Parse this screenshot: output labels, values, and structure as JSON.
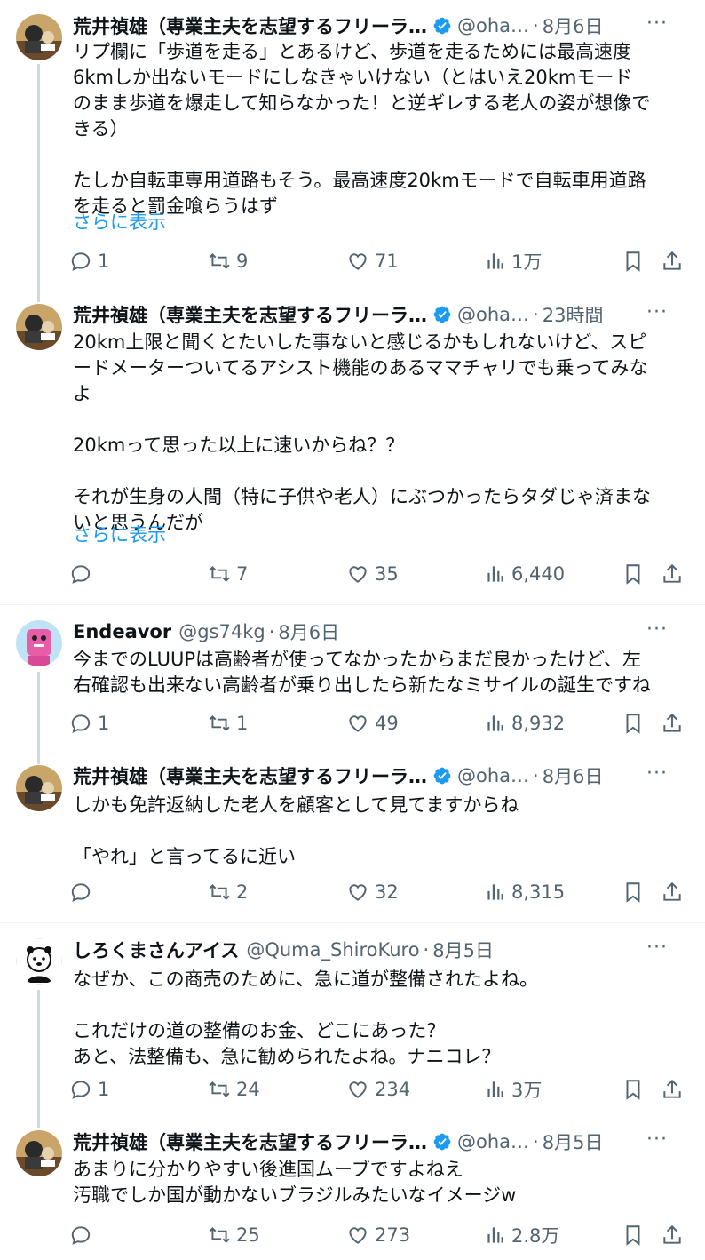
{
  "showmore_label": "さらに表示",
  "more_label": "···",
  "tweets": [
    {
      "name": "荒井禎雄（専業主夫を志望するフリーラ…",
      "handle": "@oha…",
      "dot": "·",
      "time": "8月6日",
      "verified": true,
      "text": "リプ欄に「歩道を走る」とあるけど、歩道を走るためには最高速度\n6kmしか出ないモードにしなきゃいけない（とはいえ20kmモード\nのまま歩道を爆走して知らなかった！と逆ギレする老人の姿が想像で\nきる）\n\nたしか自転車専用道路もそう。最高速度20kmモードで自転車用道路\nを走ると罰金喰らうはず",
      "show_more": true,
      "replies": "1",
      "retweets": "9",
      "likes": "71",
      "views": "1万"
    },
    {
      "name": "荒井禎雄（専業主夫を志望するフリーラ…",
      "handle": "@oha…",
      "dot": "·",
      "time": "23時間",
      "verified": true,
      "text": "20km上限と聞くとたいした事ないと感じるかもしれないけど、スピ\nードメーターついてるアシスト機能のあるママチャリでも乗ってみな\nよ\n\n20kmって思った以上に速いからね？？\n\nそれが生身の人間（特に子供や老人）にぶつかったらタダじゃ済まな\nいと思うんだが",
      "show_more": true,
      "replies": "",
      "retweets": "7",
      "likes": "35",
      "views": "6,440"
    },
    {
      "name": "Endeavor",
      "handle": "@gs74kg",
      "dot": "·",
      "time": "8月6日",
      "verified": false,
      "text": "今までのLUUPは高齢者が使ってなかったからまだ良かったけど、左\n右確認も出来ない高齢者が乗り出したら新たなミサイルの誕生ですね",
      "show_more": false,
      "replies": "1",
      "retweets": "1",
      "likes": "49",
      "views": "8,932"
    },
    {
      "name": "荒井禎雄（専業主夫を志望するフリーラ…",
      "handle": "@oha…",
      "dot": "·",
      "time": "8月6日",
      "verified": true,
      "text": "しかも免許返納した老人を顧客として見てますからね\n\n「やれ」と言ってるに近い",
      "show_more": false,
      "replies": "",
      "retweets": "2",
      "likes": "32",
      "views": "8,315"
    },
    {
      "name": "しろくまさんアイス",
      "handle": "@Quma_ShiroKuro",
      "dot": "·",
      "time": "8月5日",
      "verified": false,
      "text": "なぜか、この商売のために、急に道が整備されたよね。\n\nこれだけの道の整備のお金、どこにあった？\nあと、法整備も、急に勧められたよね。ナニコレ？",
      "show_more": false,
      "replies": "1",
      "retweets": "24",
      "likes": "234",
      "views": "3万"
    },
    {
      "name": "荒井禎雄（専業主夫を志望するフリーラ…",
      "handle": "@oha…",
      "dot": "·",
      "time": "8月5日",
      "verified": true,
      "text": "あまりに分かりやすい後進国ムーブですよねえ\n汚職でしか国が動かないブラジルみたいなイメージw",
      "show_more": false,
      "replies": "",
      "retweets": "25",
      "likes": "273",
      "views": "2.8万"
    }
  ],
  "colors": {
    "text": "#0f1419",
    "secondary": "#536471",
    "link": "#1d9bf0",
    "verified": "#1d9bf0",
    "thread_line": "#cfd9de",
    "divider": "#eff3f4"
  },
  "icons": [
    "reply-icon",
    "retweet-icon",
    "like-icon",
    "views-icon",
    "bookmark-icon",
    "share-icon",
    "verified-badge-icon",
    "more-icon"
  ]
}
